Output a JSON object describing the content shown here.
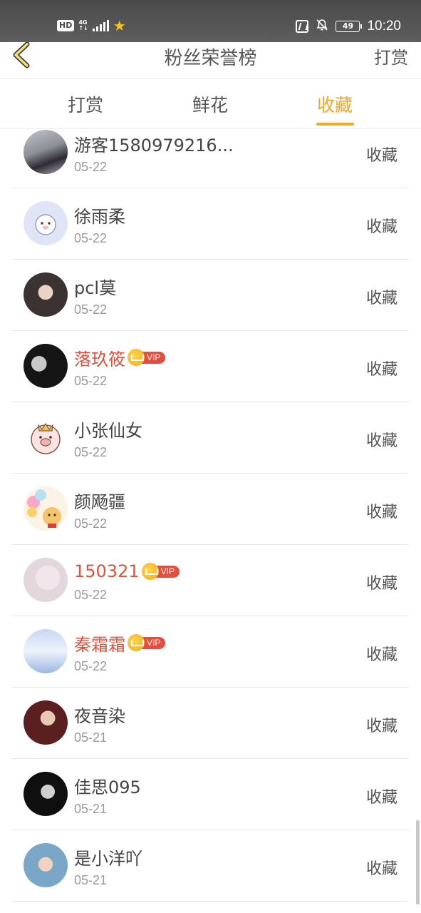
{
  "status_bar": {
    "hd": "HD",
    "network": "4G",
    "network_sub": "↑↓",
    "star_icon": "star-icon",
    "battery": "49",
    "time": "10:20"
  },
  "header": {
    "title": "粉丝荣誉榜",
    "right_link": "打赏",
    "back_icon": "chevron-left-icon"
  },
  "tabs": [
    {
      "label": "打赏",
      "active": false
    },
    {
      "label": "鲜花",
      "active": false
    },
    {
      "label": "收藏",
      "active": true
    }
  ],
  "colors": {
    "accent": "#f5a623",
    "vip_name": "#e0533a",
    "vip_tag": "#e74c3c"
  },
  "list": [
    {
      "name": "游客1580979216...",
      "date": "05-22",
      "action": "收藏",
      "vip": false
    },
    {
      "name": "徐雨柔",
      "date": "05-22",
      "action": "收藏",
      "vip": false
    },
    {
      "name": "pcl莫",
      "date": "05-22",
      "action": "收藏",
      "vip": false
    },
    {
      "name": "落玖筱",
      "date": "05-22",
      "action": "收藏",
      "vip": true,
      "vip_label": "VIP"
    },
    {
      "name": "小张仙女",
      "date": "05-22",
      "action": "收藏",
      "vip": false
    },
    {
      "name": "颜飏疆",
      "date": "05-22",
      "action": "收藏",
      "vip": false
    },
    {
      "name": "150321",
      "date": "05-22",
      "action": "收藏",
      "vip": true,
      "vip_label": "VIP"
    },
    {
      "name": "秦霜霜",
      "date": "05-22",
      "action": "收藏",
      "vip": true,
      "vip_label": "VIP"
    },
    {
      "name": "夜音染",
      "date": "05-21",
      "action": "收藏",
      "vip": false
    },
    {
      "name": "佳思095",
      "date": "05-21",
      "action": "收藏",
      "vip": false
    },
    {
      "name": "是小洋吖",
      "date": "05-21",
      "action": "收藏",
      "vip": false
    }
  ]
}
